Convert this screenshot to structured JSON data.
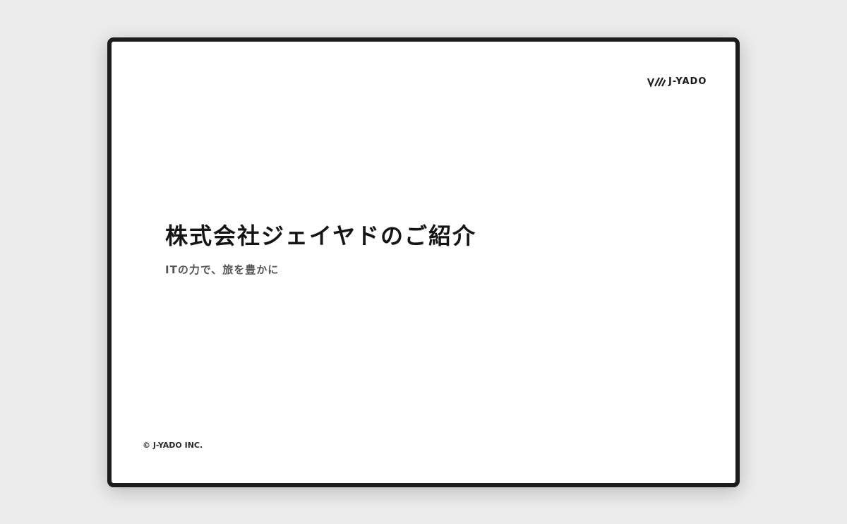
{
  "slide": {
    "logo": {
      "icon": "j-yado-mark-icon",
      "text": "J-YADO"
    },
    "title": "株式会社ジェイヤドのご紹介",
    "subtitle": "ITの力で、旅を豊かに",
    "copyright": "© J-YADO INC."
  },
  "colors": {
    "background": "#ececec",
    "frame": "#1c1c1c",
    "slide": "#ffffff",
    "title": "#141414",
    "subtitle": "#555555"
  }
}
